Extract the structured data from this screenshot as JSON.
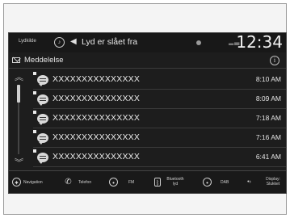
{
  "status_bar": {
    "source_label": "Lydkilde",
    "mute_text": "Lyd er slået fra",
    "clock": "12:34"
  },
  "header": {
    "title": "Meddelelse",
    "info_symbol": "i"
  },
  "messages": [
    {
      "sender": "XXXXXXXXXXXXXXX",
      "time": "8:10 AM"
    },
    {
      "sender": "XXXXXXXXXXXXXXX",
      "time": "8:09 AM"
    },
    {
      "sender": "XXXXXXXXXXXXXXX",
      "time": "7:18 AM"
    },
    {
      "sender": "XXXXXXXXXXXXXXX",
      "time": "7:16 AM"
    },
    {
      "sender": "XXXXXXXXXXXXXXX",
      "time": "6:41 AM"
    }
  ],
  "nav": {
    "navigation": "Navigation",
    "telefon": "Telefon",
    "fm": "FM",
    "bluetooth_line1": "Bluetooth",
    "bluetooth_line2": "lyd",
    "dab": "DAB",
    "display_line1": "Display:",
    "display_line2": "Slukket"
  },
  "icons": {
    "source": "mic-icon",
    "speaker": "speaker-mute-icon",
    "notification": "notification-dot-icon",
    "signal": "signal-icon",
    "message": "envelope-icon",
    "info": "info-icon",
    "scroll_up": "chevron-up-icon",
    "scroll_down": "chevron-down-icon",
    "row": "speech-bubble-icon",
    "nav": "compass-icon",
    "phone": "phone-icon",
    "radio": "radio-icon",
    "bluetooth": "bluetooth-icon",
    "display": "display-off-icon"
  },
  "colors": {
    "screen_bg": "#1d1d1d",
    "text": "#e8e8e8",
    "divider": "#3a3a3a"
  }
}
